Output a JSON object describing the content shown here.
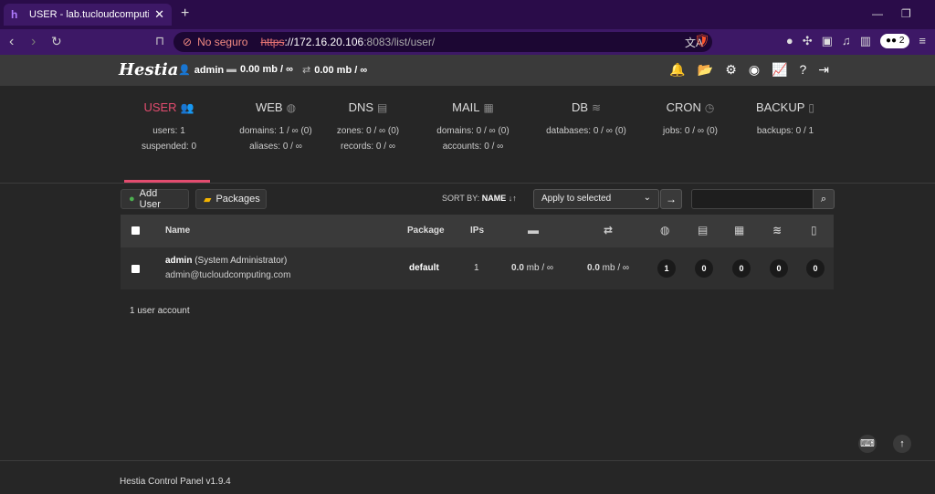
{
  "browser": {
    "tab_title": "USER - lab.tucloudcomputing.co",
    "tab_favicon": "h",
    "security_label": "No seguro",
    "url_protocol": "https",
    "url_host": "://172.16.20.106",
    "url_path": ":8083/list/user/",
    "profile_count": "2"
  },
  "header": {
    "logo": "Hestia",
    "user": "admin",
    "disk": "0.00 mb / ∞",
    "bandwidth": "0.00 mb / ∞"
  },
  "stats": [
    {
      "label": "USER",
      "icon": "users-icon",
      "lines": [
        "users: 1",
        "suspended: 0"
      ]
    },
    {
      "label": "WEB",
      "icon": "globe-icon",
      "lines": [
        "domains: 1 / ∞ (0)",
        "aliases: 0 / ∞"
      ]
    },
    {
      "label": "DNS",
      "icon": "book-icon",
      "lines": [
        "zones: 0 / ∞ (0)",
        "records: 0 / ∞"
      ]
    },
    {
      "label": "MAIL",
      "icon": "mail-server-icon",
      "lines": [
        "domains: 0 / ∞ (0)",
        "accounts: 0 / ∞"
      ]
    },
    {
      "label": "DB",
      "icon": "database-icon",
      "lines": [
        "databases: 0 / ∞ (0)"
      ]
    },
    {
      "label": "CRON",
      "icon": "clock-icon",
      "lines": [
        "jobs: 0 / ∞ (0)"
      ]
    },
    {
      "label": "BACKUP",
      "icon": "file-archive-icon",
      "lines": [
        "backups: 0 / 1"
      ]
    }
  ],
  "toolbar": {
    "add_user": "Add User",
    "packages": "Packages",
    "sort_by_label": "SORT BY:",
    "sort_by_value": "NAME",
    "bulk_action": "Apply to selected"
  },
  "table": {
    "headers": {
      "name": "Name",
      "package": "Package",
      "ips": "IPs"
    },
    "rows": [
      {
        "username": "admin",
        "fullname": " (System Administrator)",
        "email": "admin@tucloudcomputing.com",
        "package": "default",
        "ips": "1",
        "disk_value": "0.0",
        "disk_unit": " mb / ∞",
        "bw_value": "0.0",
        "bw_unit": " mb / ∞",
        "web": "1",
        "dns": "0",
        "mail": "0",
        "db": "0",
        "backup": "0"
      }
    ]
  },
  "summary": "1 user account",
  "footer": "Hestia Control Panel v1.9.4"
}
